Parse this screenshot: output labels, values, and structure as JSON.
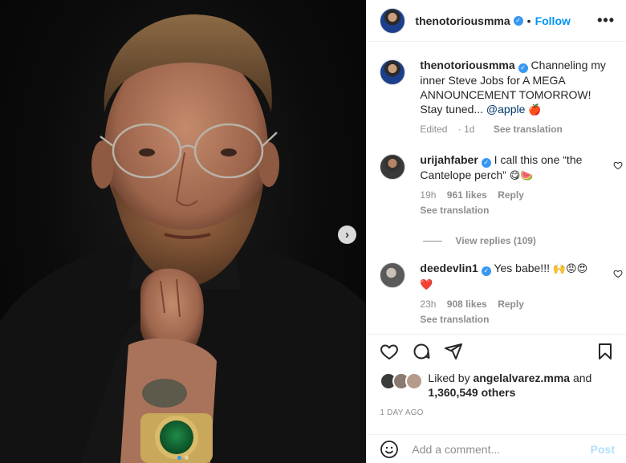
{
  "post": {
    "author": "thenotoriousmma",
    "follow_label": "Follow",
    "separator": "•",
    "more_label": "•••",
    "caption": {
      "username": "thenotoriousmma",
      "text_before": "Channeling my inner Steve Jobs for A MEGA ANNOUNCEMENT TOMORROW! Stay tuned...",
      "mention": "@apple",
      "emoji": "🍎",
      "edited": "Edited",
      "time": "1d",
      "see_translation": "See translation"
    },
    "comments": [
      {
        "username": "urijahfaber",
        "text": "I call this one “the Cantelope perch”",
        "emoji": "😋🍉",
        "time": "19h",
        "likes": "961 likes",
        "reply": "Reply",
        "see_translation": "See translation",
        "view_replies": "View replies (109)"
      },
      {
        "username": "deedevlin1",
        "text": "Yes babe!!!",
        "emoji": "🙌😡😍",
        "emoji2": "❤️",
        "time": "23h",
        "likes": "908 likes",
        "reply": "Reply",
        "see_translation": "See translation"
      }
    ],
    "liked_by_prefix": "Liked by",
    "liked_by_user": "angelalvarez.mma",
    "liked_by_and": "and",
    "liked_by_others": "1,360,549 others",
    "date": "1 DAY AGO",
    "comment_placeholder": "Add a comment...",
    "post_label": "Post",
    "next_label": "›"
  },
  "colors": {
    "accent": "#0095f6",
    "verified": "#3897f0",
    "muted": "#8e8e8e",
    "post_disabled": "#b2dffc",
    "heart": "#ed4956"
  },
  "icons": [
    "verified-badge-icon",
    "heart-icon",
    "comment-icon",
    "share-icon",
    "bookmark-icon",
    "emoji-icon",
    "chevron-right-icon",
    "more-icon"
  ]
}
